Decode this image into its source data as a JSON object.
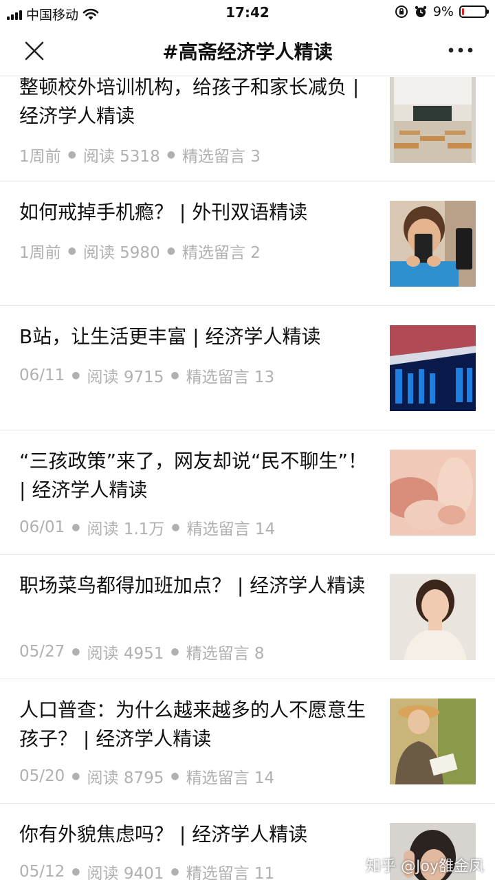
{
  "status_bar": {
    "carrier": "中国移动",
    "time": "17:42",
    "battery_text": "9%",
    "battery_level": 0.09
  },
  "nav": {
    "title": "#高斋经济学人精读",
    "close_icon": "close-icon",
    "more_icon": "more-icon"
  },
  "articles": [
    {
      "title": "整顿校外培训机构，给孩子和家长减负 | 经济学人精读",
      "date": "1周前",
      "reads": "阅读 5318",
      "comments": "精选留言 3",
      "thumb": "classroom"
    },
    {
      "title": "如何戒掉手机瘾？ | 外刊双语精读",
      "date": "1周前",
      "reads": "阅读 5980",
      "comments": "精选留言 2",
      "thumb": "boy-with-phone"
    },
    {
      "title": "B站，让生活更丰富 | 经济学人精读",
      "date": "06/11",
      "reads": "阅读 9715",
      "comments": "精选留言 13",
      "thumb": "bilibili-sign"
    },
    {
      "title": "“三孩政策”来了，网友却说“民不聊生”！ | 经济学人精读",
      "date": "06/01",
      "reads": "阅读 1.1万",
      "comments": "精选留言 14",
      "thumb": "baby-feet"
    },
    {
      "title": "职场菜鸟都得加班加点？ | 经济学人精读",
      "date": "05/27",
      "reads": "阅读 4951",
      "comments": "精选留言 8",
      "thumb": "smiling-woman"
    },
    {
      "title": "人口普查：为什么越来越多的人不愿意生孩子？ | 经济学人精读",
      "date": "05/20",
      "reads": "阅读 8795",
      "comments": "精选留言 14",
      "thumb": "woman-reading"
    },
    {
      "title": "你有外貌焦虑吗？ | 经济学人精读",
      "date": "05/12",
      "reads": "阅读 9401",
      "comments": "精选留言 11",
      "thumb": "worried-woman"
    }
  ],
  "watermark": "知乎 @Joy雒金凤"
}
